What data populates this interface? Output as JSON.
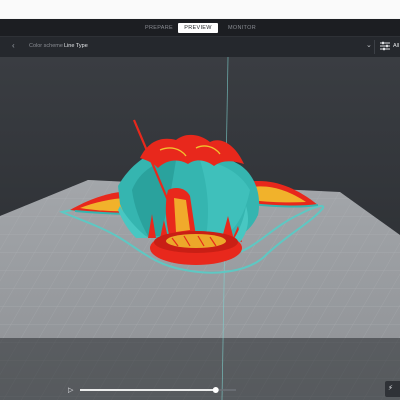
{
  "stages": {
    "prepare": "PREPARE",
    "preview": "PREVIEW",
    "monitor": "MONITOR",
    "active": "preview"
  },
  "toolbar": {
    "color_scheme_label": "Color scheme",
    "color_scheme_value": "Line Type",
    "settings_label": "All"
  },
  "icons": {
    "toolbar_left": "chevron-left-icon",
    "scheme_dropdown": "chevron-down-icon",
    "settings": "sliders-icon",
    "play": "play-icon",
    "bottom_right": "lightning-icon"
  },
  "colors": {
    "wall_outer": "#e8281c",
    "wall_inner": "#35b5b0",
    "infill": "#f2c12e",
    "skin": "#f2c12e",
    "viewport_bg": "#2b2e33",
    "build_plate": "#909399",
    "accent": "#ffffff"
  },
  "simulation": {
    "progress": 0.87
  }
}
